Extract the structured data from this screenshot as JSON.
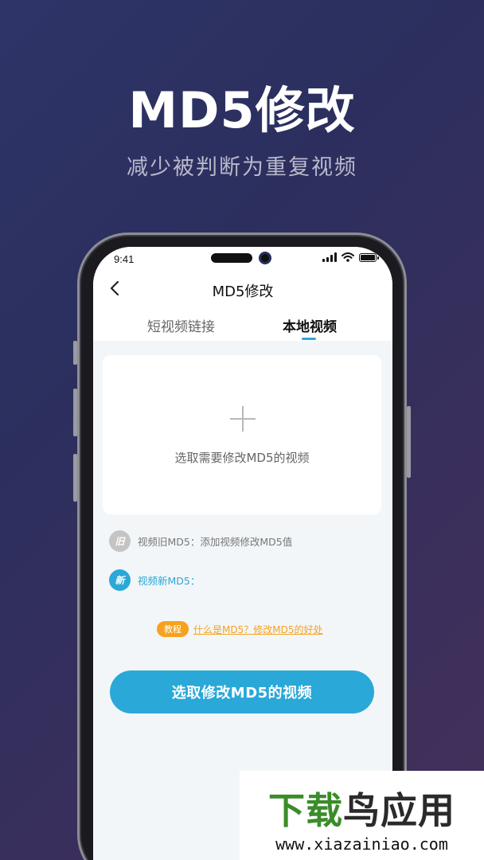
{
  "hero": {
    "title": "MD5修改",
    "subtitle": "减少被判断为重复视频"
  },
  "status_bar": {
    "time": "9:41"
  },
  "nav": {
    "title": "MD5修改",
    "back_icon": "chevron-left-icon"
  },
  "tabs": [
    {
      "label": "短视频链接",
      "active": false
    },
    {
      "label": "本地视频",
      "active": true
    }
  ],
  "upload": {
    "icon": "plus-icon",
    "label": "选取需要修改MD5的视频"
  },
  "md5": {
    "old_badge": "旧",
    "old_text": "视频旧MD5：添加视频修改MD5值",
    "new_badge": "新",
    "new_text": "视频新MD5："
  },
  "tutorial": {
    "badge": "教程",
    "link": "什么是MD5？修改MD5的好处"
  },
  "main_button": {
    "label": "选取修改MD5的视频"
  },
  "watermark": {
    "logo_part1": "下载",
    "logo_part2": "鸟应用",
    "url": "www.xiazainiao.com"
  },
  "colors": {
    "accent": "#2aa8d8",
    "tutorial": "#f6a21e",
    "background_start": "#2e3468",
    "background_end": "#43305a"
  }
}
